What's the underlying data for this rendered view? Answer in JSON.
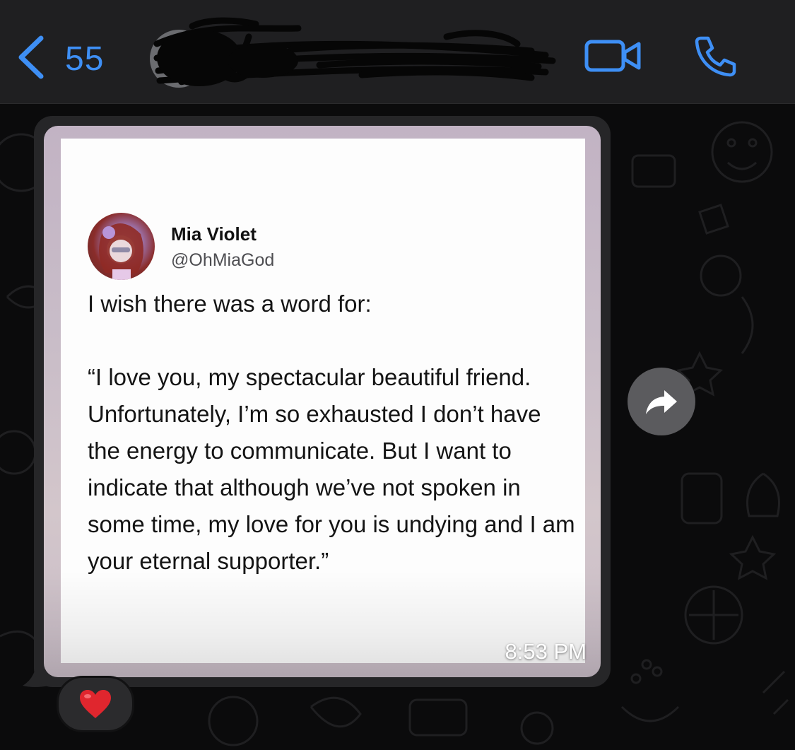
{
  "header": {
    "back_count": "55",
    "contact_name": "",
    "accent_color": "#3e8ff5",
    "icons": [
      "chevron-left-icon",
      "video-camera-icon",
      "phone-icon"
    ]
  },
  "message": {
    "timestamp": "8:53 PM",
    "reaction": "❤️",
    "tweet": {
      "name": "Mia Violet",
      "handle": "@OhMiaGod",
      "body": "I wish there was a word for:\n\n“I love you, my spectacular beautiful friend. Unfortunately, I’m so exhausted I don’t have the energy to communicate. But I want to indicate that although we’ve not spoken in some time, my love for you is undying and I am your eternal supporter.”"
    },
    "forward_icon": "forward-arrow-icon"
  }
}
